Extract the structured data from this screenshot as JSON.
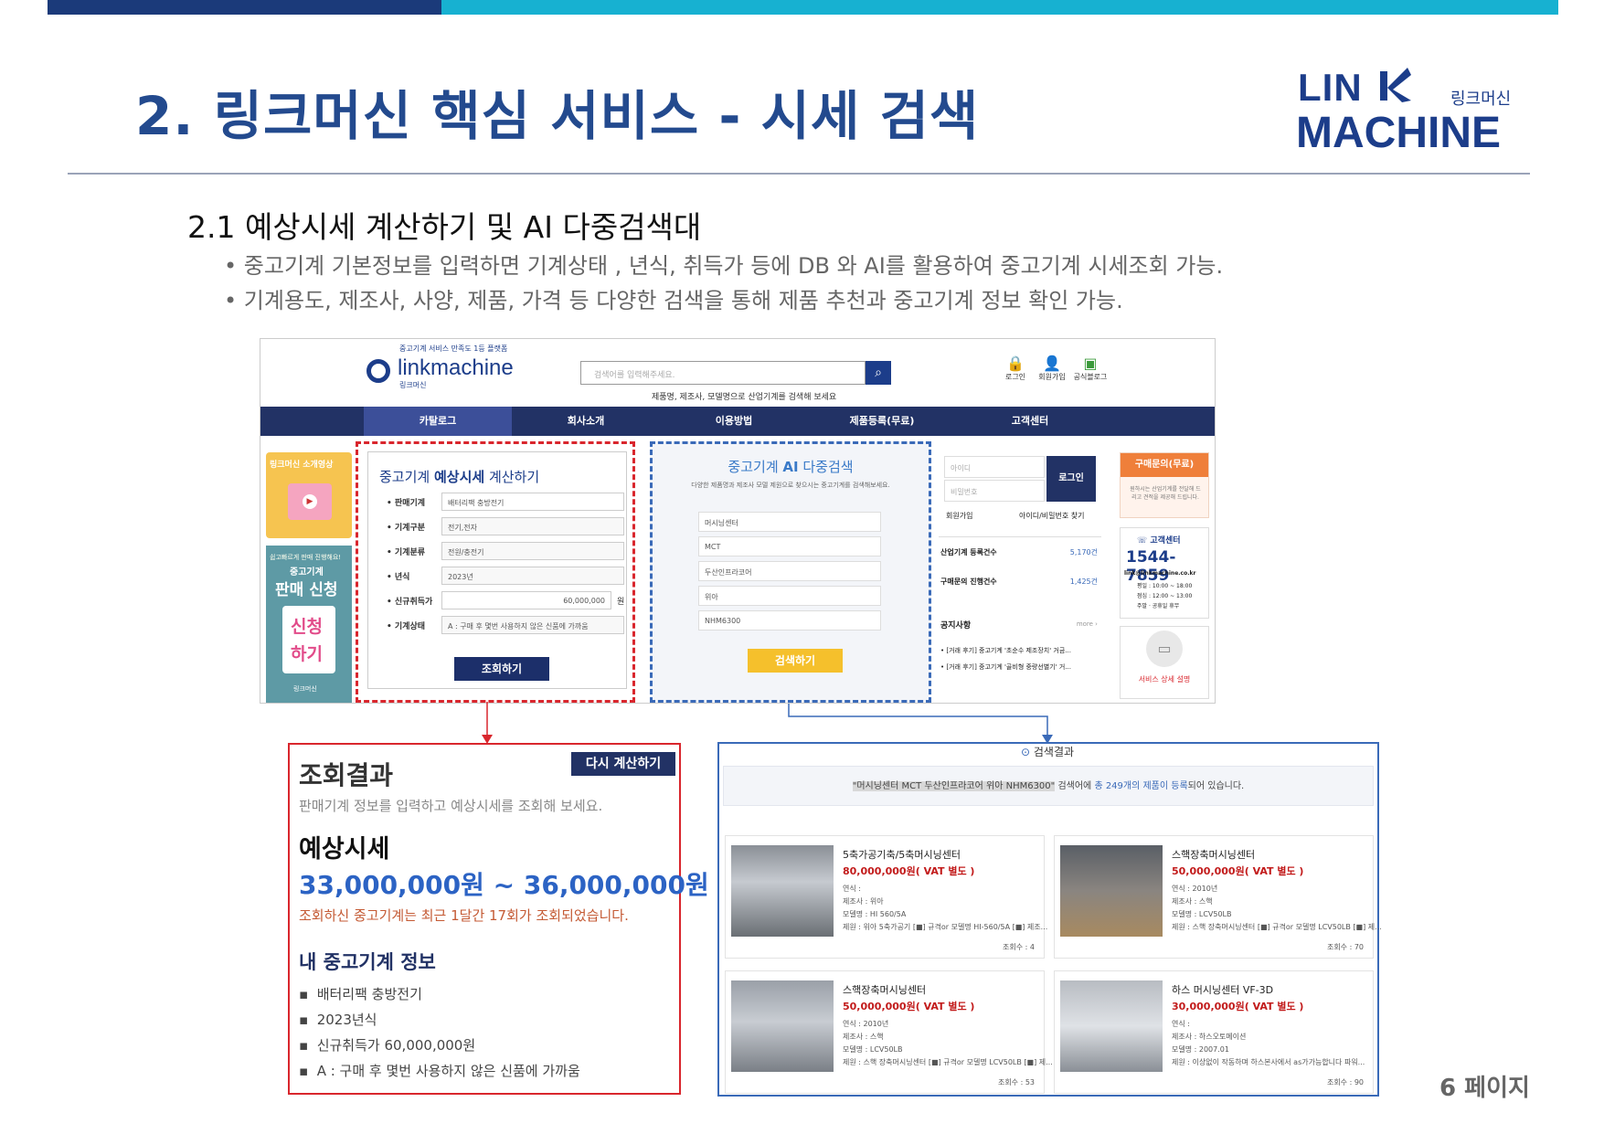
{
  "slide": {
    "title": "2. 링크머신 핵심 서비스  - 시세 검색",
    "logo_line1": "LIN",
    "logo_line2": "MACHINE",
    "logo_kr": "링크머신",
    "subheading": "2.1 예상시세 계산하기 및 AI 다중검색대",
    "bullets": [
      "• 중고기계 기본정보를 입력하면 기계상태 , 년식, 취득가 등에 DB 와 AI를 활용하여 중고기계 시세조회 가능.",
      "• 기계용도, 제조사, 사양, 제품, 가격 등 다양한 검색을 통해 제품 추천과 중고기계 정보 확인 가능."
    ],
    "page_number": "6 페이지"
  },
  "site": {
    "tagline": "중고기계 서비스 만족도 1등 플랫폼",
    "brand": "linkmachine",
    "brand_kr": "링크머신",
    "search_placeholder": "검색어를 입력해주세요.",
    "search_hint": "제품명, 제조사, 모델명으로 산업기계를 검색해 보세요",
    "top_icons": [
      {
        "icon": "lock-icon",
        "glyph": "🔒",
        "label": "로그인"
      },
      {
        "icon": "user-icon",
        "glyph": "👤",
        "label": "회원가입"
      },
      {
        "icon": "blog-icon",
        "glyph": "▣",
        "label": "공식블로그"
      }
    ],
    "nav": [
      "카탈로그",
      "회사소개",
      "이용방법",
      "제품등록(무료)",
      "고객센터"
    ],
    "left_banner_1": "링크머신 소개영상",
    "left_banner_2a": "중고기계",
    "left_banner_2b": "판매 신청",
    "left_banner_2c": "신청",
    "left_banner_2d": "하기",
    "left_banner_2e": "링크머신",
    "left_banner_2top": "쉽고빠르게 판매 진행해요!",
    "calc": {
      "title_a": "중고기계 ",
      "title_b": "예상시세",
      "title_c": " 계산하기",
      "rows": [
        {
          "label": "• 판매기계",
          "value": "배터리팩 충방전기"
        },
        {
          "label": "• 기계구분",
          "value": "전기,전자"
        },
        {
          "label": "• 기계분류",
          "value": "전원/충전기"
        },
        {
          "label": "• 년식",
          "value": "2023년"
        },
        {
          "label": "• 신규취득가",
          "value": "60,000,000"
        },
        {
          "label": "• 기계상태",
          "value": "A : 구매 후 몇번 사용하지 않은 신품에 가까움"
        }
      ],
      "unit": "원",
      "button": "조회하기"
    },
    "ai": {
      "title_a": "중고기계 ",
      "title_b": "AI",
      "title_c": " 다중검색",
      "desc": "다양한 제품명과 제조사 모델 제원으로 찾으시는 중고기계를 검색해보세요.",
      "fields": [
        "머시닝센터",
        "MCT",
        "두산인프라코어",
        "위아",
        "NHM6300"
      ],
      "button": "검색하기"
    },
    "login": {
      "id_placeholder": "아이디",
      "pw_placeholder": "비밀번호",
      "button": "로그인",
      "join": "회원가입",
      "find": "아이디/비밀번호 찾기",
      "stat1_label": "산업기계 등록건수",
      "stat1_value": "5,170건",
      "stat2_label": "구매문의 진행건수",
      "stat2_value": "1,425건",
      "notice_title": "공지사항",
      "notice_more": "more ›",
      "notices": [
        "• [거래 후기] 중고기계 '초순수 제조장치' 거금...",
        "• [거래 후기] 중고기계 '골비형 중량선별기' 거..."
      ]
    },
    "right": {
      "inquiry": "구매문의(무료)",
      "inquiry_desc": "원하시는 산업기계를 전달해 드리고 견적을 제공해 드립니다.",
      "cs_title": "고객센터",
      "phone": "1544-7859",
      "email": "link@linkmachine.co.kr",
      "hours1": "평일 : 10:00 ~ 18:00",
      "hours2": "점심 : 12:00 ~ 13:00",
      "hours3": "주말 · 공휴일 휴무",
      "service": "서비스 상세 설명"
    }
  },
  "result_left": {
    "title": "조회결과",
    "recalc": "다시 계산하기",
    "desc": "판매기계 정보를 입력하고 예상시세를 조회해 보세요.",
    "price_label": "예상시세",
    "price_range": "33,000,000원 ~ 36,000,000원",
    "note": "조회하신 중고기계는 최근 1달간 17회가 조회되었습니다.",
    "info_title": "내 중고기계 정보",
    "info": [
      "배터리팩 충방전기",
      "2023년식",
      "신규취득가 60,000,000원",
      "A : 구매 후 몇번 사용하지 않은 신품에 가까움"
    ]
  },
  "result_right": {
    "title": "검색결과",
    "summary_q": "\"머시닝센터 MCT 두산인프라코어 위아 NHM6300\"",
    "summary_a": " 검색어에 ",
    "summary_b": "총 249개의 제품이 등록",
    "summary_c": "되어 있습니다.",
    "cards": [
      {
        "title": "5축가공기축/5축머시닝센터",
        "price": "80,000,000원( VAT 별도 )",
        "year": "연식 :",
        "maker": "제조사 : 위아",
        "model": "모델명 : HI 560/5A",
        "spec": "제원 : 위아 5축가공기 [■] 규격or 모델명 HI-560/5A [■] 제조...",
        "views": "조회수 : 4"
      },
      {
        "title": "스핵장축머시닝센터",
        "price": "50,000,000원( VAT 별도 )",
        "year": "연식 : 2010년",
        "maker": "제조사 : 스핵",
        "model": "모델명 : LCV50LB",
        "spec": "제원 : 스핵 장축머시닝센터 [■] 규격or 모델명 LCV50LB [■] 제...",
        "views": "조회수 : 70"
      },
      {
        "title": "스핵장축머시닝센터",
        "price": "50,000,000원( VAT 별도 )",
        "year": "연식 : 2010년",
        "maker": "제조사 : 스핵",
        "model": "모델명 : LCV50LB",
        "spec": "제원 : 스핵 장축머시닝센터 [■] 규격or 모델명 LCV50LB [■] 제...",
        "views": "조회수 : 53"
      },
      {
        "title": "하스 머시닝센터 VF-3D",
        "price": "30,000,000원( VAT 별도 )",
        "year": "연식 :",
        "maker": "제조사 : 하스오토메이션",
        "model": "모델명 : 2007.01",
        "spec": "제원 : 이상없이 작동하며 하스본사에서 as가가능합니다 파워...",
        "views": "조회수 : 90"
      }
    ]
  },
  "colors": {
    "navy": "#1c3d8a",
    "red": "#d9262d",
    "blue": "#3a6ab8",
    "accent_cyan": "#17b1d1",
    "yellow_btn": "#f5c02c"
  }
}
